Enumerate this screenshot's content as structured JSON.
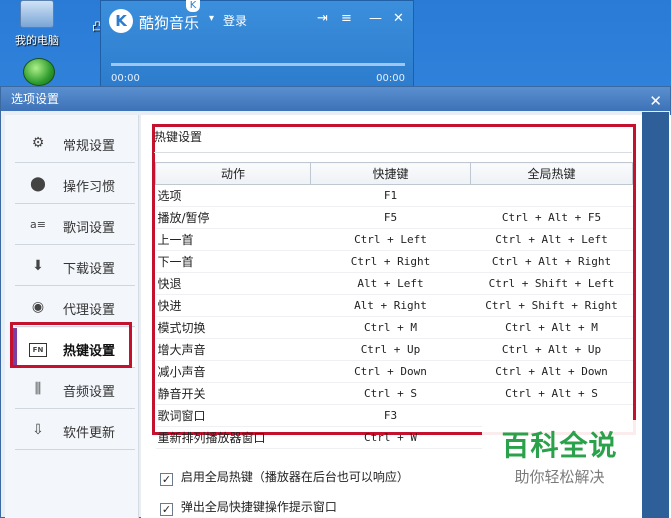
{
  "desktop": {
    "icon_my_computer": "我的电脑",
    "icon_partial": "凸"
  },
  "player": {
    "logo": "K",
    "title": "酷狗音乐",
    "login": "登录",
    "time_start": "00:00",
    "time_end": "00:00",
    "badge": "K"
  },
  "dialog": {
    "title": "选项设置",
    "close": "✕"
  },
  "sidebar": {
    "items": [
      {
        "label": "常规设置",
        "icon": "gear-icon",
        "glyph": "⚙"
      },
      {
        "label": "操作习惯",
        "icon": "pin-icon",
        "glyph": "⬤"
      },
      {
        "label": "歌词设置",
        "icon": "lyrics-icon",
        "glyph": "a≡"
      },
      {
        "label": "下载设置",
        "icon": "download-icon",
        "glyph": "⬇"
      },
      {
        "label": "代理设置",
        "icon": "globe-icon",
        "glyph": "◉"
      },
      {
        "label": "热键设置",
        "icon": "fn-key-icon",
        "glyph": "FN"
      },
      {
        "label": "音频设置",
        "icon": "equalizer-icon",
        "glyph": "⫼"
      },
      {
        "label": "软件更新",
        "icon": "update-icon",
        "glyph": "⇩"
      }
    ],
    "active_index": 5
  },
  "hotkeys": {
    "section_title": "热键设置",
    "columns": [
      "动作",
      "快捷键",
      "全局热键"
    ],
    "rows": [
      [
        "选项",
        "F1",
        ""
      ],
      [
        "播放/暂停",
        "F5",
        "Ctrl + Alt + F5"
      ],
      [
        "上一首",
        "Ctrl + Left",
        "Ctrl + Alt + Left"
      ],
      [
        "下一首",
        "Ctrl + Right",
        "Ctrl + Alt + Right"
      ],
      [
        "快退",
        "Alt + Left",
        "Ctrl + Shift + Left"
      ],
      [
        "快进",
        "Alt + Right",
        "Ctrl + Shift + Right"
      ],
      [
        "模式切换",
        "Ctrl + M",
        "Ctrl + Alt + M"
      ],
      [
        "增大声音",
        "Ctrl + Up",
        "Ctrl + Alt + Up"
      ],
      [
        "减小声音",
        "Ctrl + Down",
        "Ctrl + Alt + Down"
      ],
      [
        "静音开关",
        "Ctrl + S",
        "Ctrl + Alt + S"
      ],
      [
        "歌词窗口",
        "F3",
        ""
      ],
      [
        "重新排列播放器窗口",
        "Ctrl + W",
        ""
      ]
    ]
  },
  "options": {
    "enable_global": {
      "label": "启用全局热键（播放器在后台也可以响应）",
      "checked": true
    },
    "show_tip": {
      "label": "弹出全局快捷键操作提示窗口",
      "checked": true
    }
  },
  "watermark": {
    "line1": "百科全说",
    "line2": "助你轻松解决"
  },
  "colors": {
    "highlight_frame": "#c4122e",
    "titlebar": "#3d72b8",
    "watermark_green": "#2aa14a"
  }
}
